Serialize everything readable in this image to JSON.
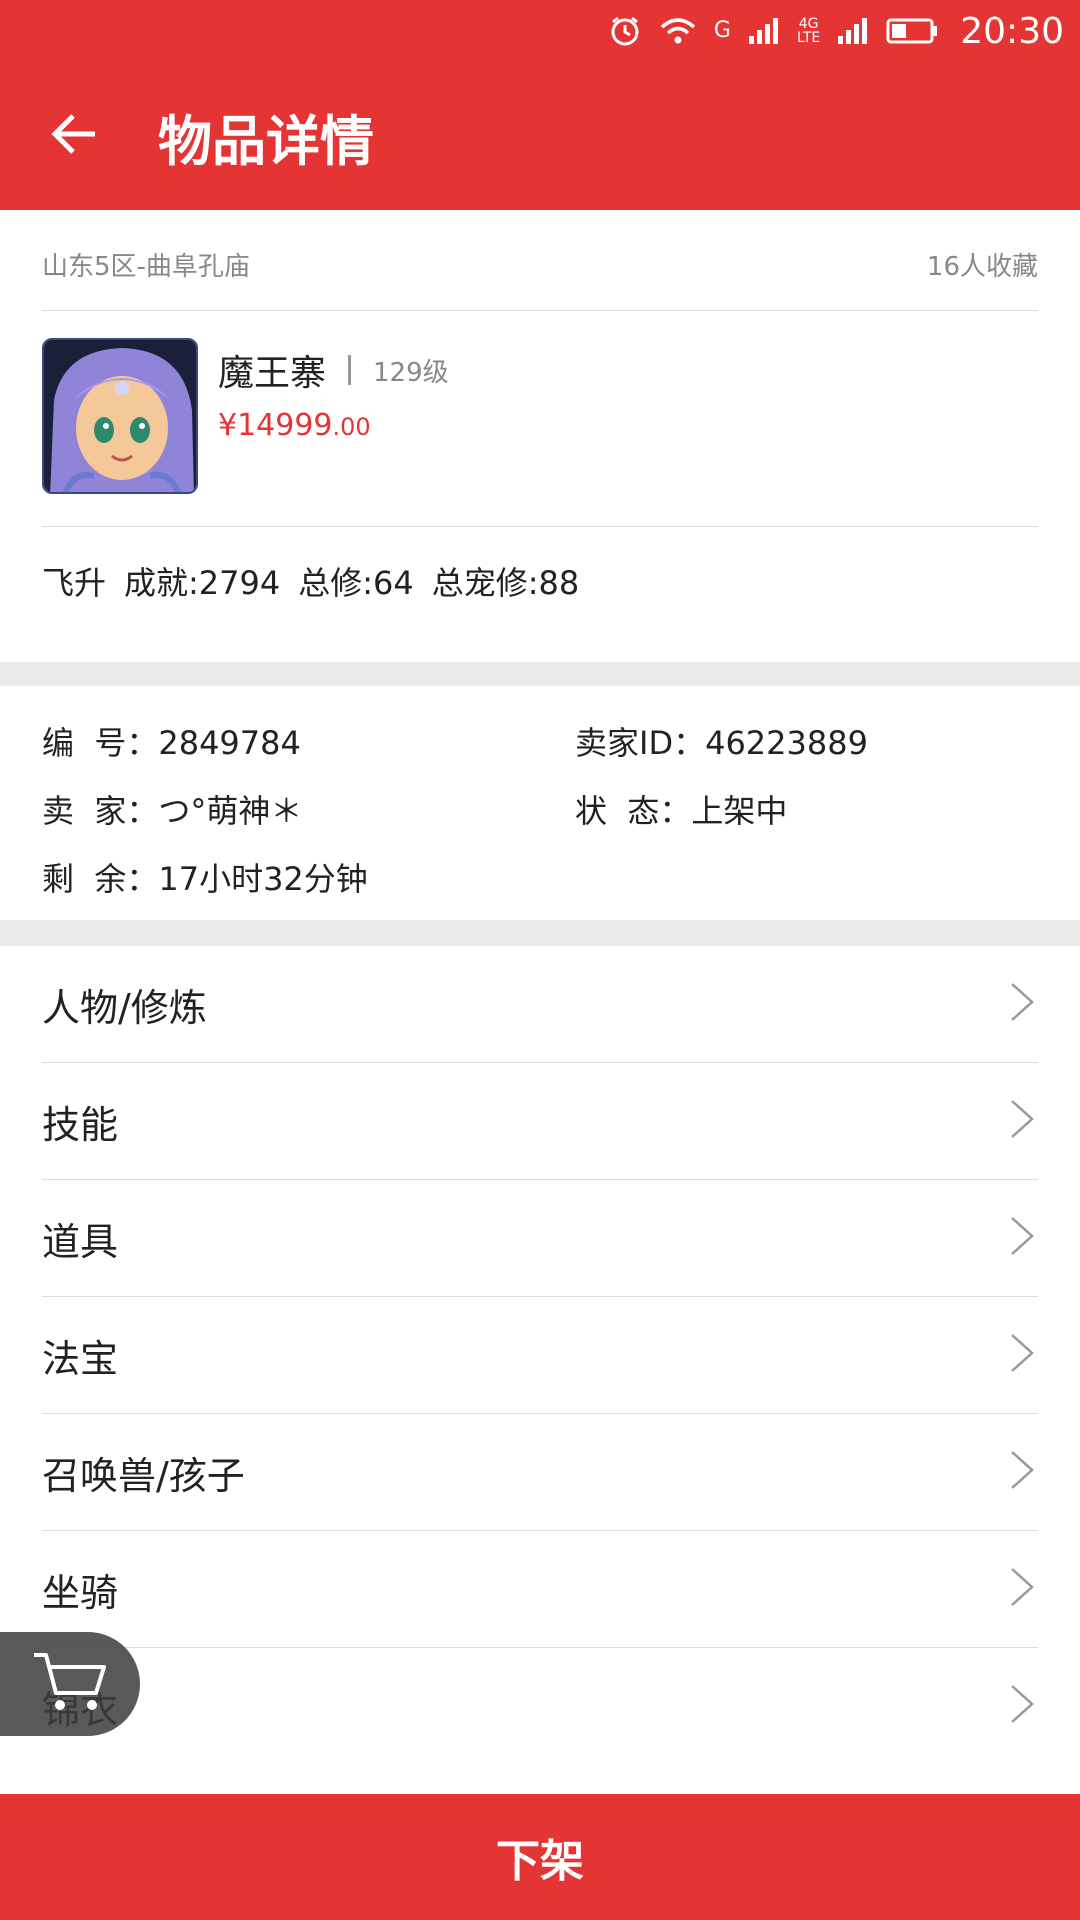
{
  "status_bar": {
    "network_g": "G",
    "network_4g": "4G",
    "network_lte": "LTE",
    "time": "20:30",
    "icons": [
      "alarm-icon",
      "wifi-icon",
      "signal-icon",
      "signal-icon",
      "battery-icon"
    ]
  },
  "header": {
    "title": "物品详情",
    "back_icon": "arrow-left-icon"
  },
  "item": {
    "server": "山东5区-曲阜孔庙",
    "favorites": "16人收藏",
    "name": "魔王寨",
    "level": "129级",
    "price_main": "¥14999",
    "price_cents": ".00",
    "tags": [
      "飞升",
      "成就:2794",
      "总修:64",
      "总宠修:88"
    ]
  },
  "details": {
    "serial": "编  号：2849784",
    "seller_id": "卖家ID：46223889",
    "seller": "卖  家：つ°萌神＊",
    "status": "状  态：上架中",
    "remaining": "剩  余：17小时32分钟"
  },
  "menu": [
    {
      "label": "人物/修炼"
    },
    {
      "label": "技能"
    },
    {
      "label": "道具"
    },
    {
      "label": "法宝"
    },
    {
      "label": "召唤兽/孩子"
    },
    {
      "label": "坐骑"
    },
    {
      "label": "锦衣"
    }
  ],
  "footer": {
    "button_label": "下架"
  },
  "colors": {
    "primary": "#e53434",
    "band": "#ebebeb",
    "divider": "#dcdcdc"
  }
}
